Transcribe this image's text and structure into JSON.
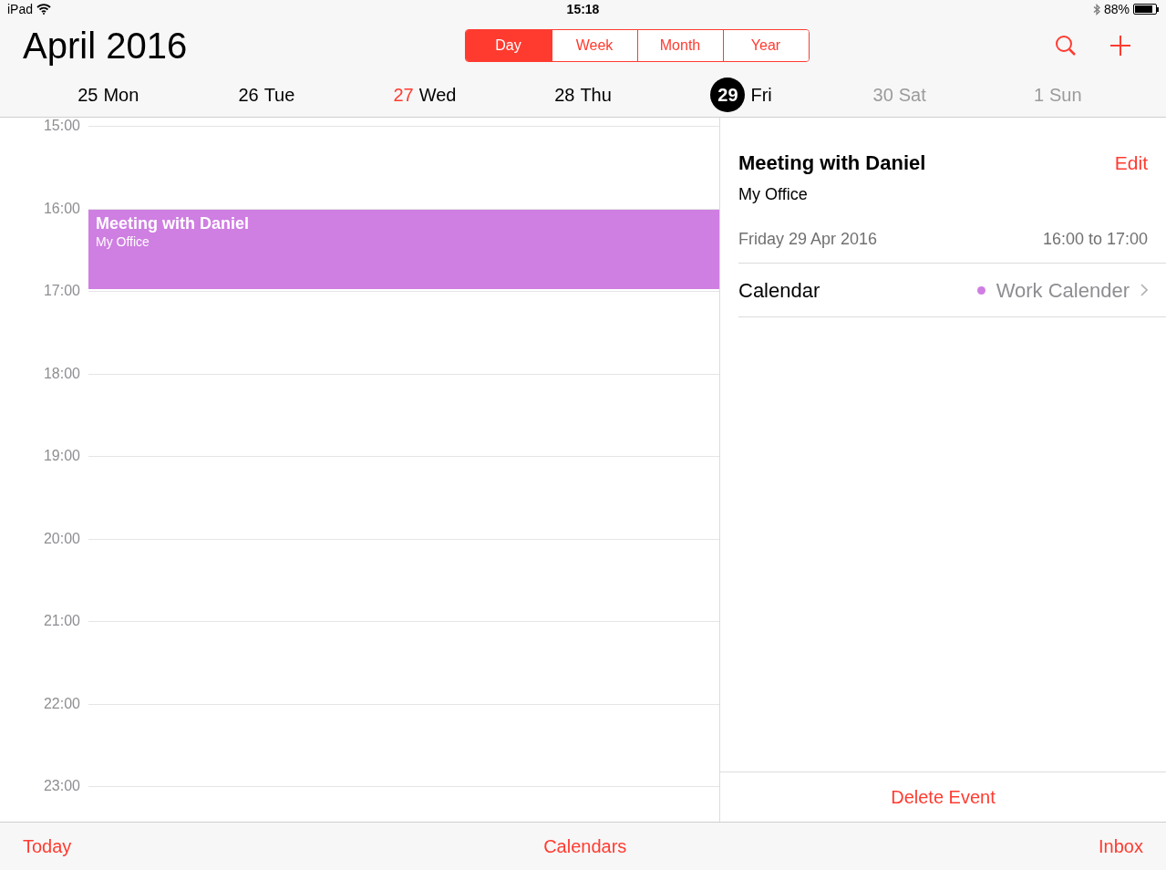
{
  "status_bar": {
    "device": "iPad",
    "time": "15:18",
    "battery": "88%"
  },
  "header": {
    "month": "April",
    "year": "2016"
  },
  "view_tabs": [
    {
      "label": "Day",
      "selected": true
    },
    {
      "label": "Week",
      "selected": false
    },
    {
      "label": "Month",
      "selected": false
    },
    {
      "label": "Year",
      "selected": false
    }
  ],
  "days": [
    {
      "number": "25",
      "weekday": "Mon",
      "today": false,
      "selected": false,
      "weekend": false
    },
    {
      "number": "26",
      "weekday": "Tue",
      "today": false,
      "selected": false,
      "weekend": false
    },
    {
      "number": "27",
      "weekday": "Wed",
      "today": true,
      "selected": false,
      "weekend": false
    },
    {
      "number": "28",
      "weekday": "Thu",
      "today": false,
      "selected": false,
      "weekend": false
    },
    {
      "number": "29",
      "weekday": "Fri",
      "today": false,
      "selected": true,
      "weekend": false
    },
    {
      "number": "30",
      "weekday": "Sat",
      "today": false,
      "selected": false,
      "weekend": true
    },
    {
      "number": "1",
      "weekday": "Sun",
      "today": false,
      "selected": false,
      "weekend": true
    }
  ],
  "hours": [
    {
      "label": "15:00"
    },
    {
      "label": "16:00",
      "events": [
        {
          "title": "Meeting with Daniel",
          "location": "My Office",
          "color": "#cf7ee2"
        }
      ]
    },
    {
      "label": "17:00"
    },
    {
      "label": "18:00"
    },
    {
      "label": "19:00"
    },
    {
      "label": "20:00"
    },
    {
      "label": "21:00"
    },
    {
      "label": "22:00"
    },
    {
      "label": "23:00"
    }
  ],
  "details": {
    "title": "Meeting with Daniel",
    "edit": "Edit",
    "location": "My Office",
    "date": "Friday 29 Apr 2016",
    "time": "16:00 to 17:00",
    "calendar": {
      "label": "Calendar",
      "name": "Work Calender",
      "color": "#cf7ee2"
    },
    "delete": "Delete Event"
  },
  "toolbar": [
    "Today",
    "Calendars",
    "Inbox"
  ]
}
